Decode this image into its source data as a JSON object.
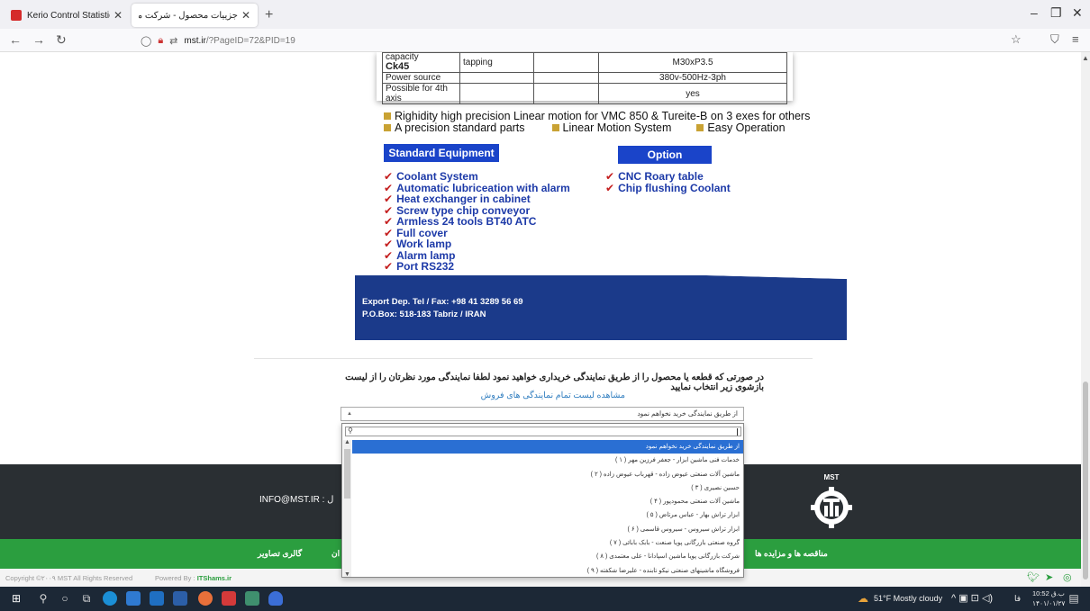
{
  "browser": {
    "tabs": [
      {
        "title": "Kerio Control Statistics",
        "active": false
      },
      {
        "title": "جزییات محصول - شرکت ماشین سازی",
        "active": true
      }
    ],
    "new_tab": "+",
    "window": {
      "minimize": "–",
      "maximize": "❐",
      "close": "✕"
    },
    "address": {
      "host": "mst.ir",
      "path": "/?PageID=72&PID=19"
    }
  },
  "spec_table": {
    "rows": [
      {
        "c1": "capacity",
        "c1b": "Ck45",
        "c2": "tapping",
        "c3": "",
        "c4": "M30xP3.5"
      },
      {
        "c1": "Power source",
        "c4": "380v-500Hz-3ph"
      },
      {
        "c1": "Possible for 4th axis",
        "c4": "yes"
      }
    ]
  },
  "features": {
    "line1": "Righidity high precision Linear motion for VMC 850  & Tureite-B on 3 exes for others",
    "line2a": "A precision standard parts",
    "line2b": "Linear Motion System",
    "line2c": "Easy Operation"
  },
  "standard_equipment": {
    "title": "Standard Equipment",
    "items": [
      "Coolant System",
      "Automatic lubriceation with alarm",
      "Heat exchanger in cabinet",
      "Screw type chip conveyor",
      "Armless 24 tools BT40 ATC",
      "Full cover",
      "Work lamp",
      "Alarm lamp",
      "Port RS232"
    ]
  },
  "option": {
    "title": "Option",
    "items": [
      "CNC Roary table",
      "Chip flushing Coolant"
    ]
  },
  "export": {
    "line1": "Export Dep.  Tel / Fax: +98 41 3289 56 69",
    "line2": "P.O.Box: 518-183 Tabriz / IRAN"
  },
  "purchase": {
    "notice": "در صورتی که قطعه یا محصول را از طریق نمایندگی خریداری خواهید نمود لطفا نمایندگی مورد نظرتان را از لیست بازشوی زیر انتخاب نمایید",
    "link": "مشاهده لیست تمام نمایندگی های فروش",
    "select_value": "از طریق نمایندگی خرید نخواهم نمود",
    "options": [
      "از طریق نمایندگی خرید نخواهم نمود",
      "خدمات فنی ماشین ابزار - جعفر فرزین مهر ( ۱ )",
      "ماشین آلات صنعتی عیوض زاده - قهرباب عیوض زاده ( ۲ )",
      "حسین نصیری ( ۳ )",
      "ماشین آلات صنعتی محمودپور ( ۴ )",
      "ابزار تراش بهار - عباس مرتاض ( ۵ )",
      "ابزار تراش سیروس - سیروس قاسمی ( ۶ )",
      "گروه صنعتی بازرگانی پویا صنعت - بابک بابائی ( ۷ )",
      "شرکت بازرگانی پویا ماشین اسپادانا - علی معتمدی ( ۸ )",
      "فروشگاه ماشینهای صنعتی نیکو تابنده - علیرضا شکفته ( ۹ )"
    ]
  },
  "footer": {
    "logo_text": "MST",
    "email": "INFO@MST.IR : ل",
    "green_links": [
      "مناقصه ها و مزایده ها",
      "گالری تصاویر",
      "ان"
    ],
    "copyright": "Copyright ©۲۰۰۹ MST All Rights Reserved",
    "copyright_brand": "MST",
    "powered_prefix": "Powered By :",
    "powered_brand": "ITShams.ir"
  },
  "taskbar": {
    "weather": "51°F  Mostly cloudy",
    "time": "10:52 ب.ق",
    "date": "۱۴۰۱/۰۱/۲۷",
    "lang": "فا"
  },
  "colors": {
    "accent_blue": "#1a44c9",
    "checklist_text": "#1d3aa8",
    "check_red": "#c41e1e",
    "gold": "#c9a233",
    "footer_dark": "#2a2f33",
    "footer_green": "#2b9e3f",
    "navy_band": "#1b3a8a"
  }
}
